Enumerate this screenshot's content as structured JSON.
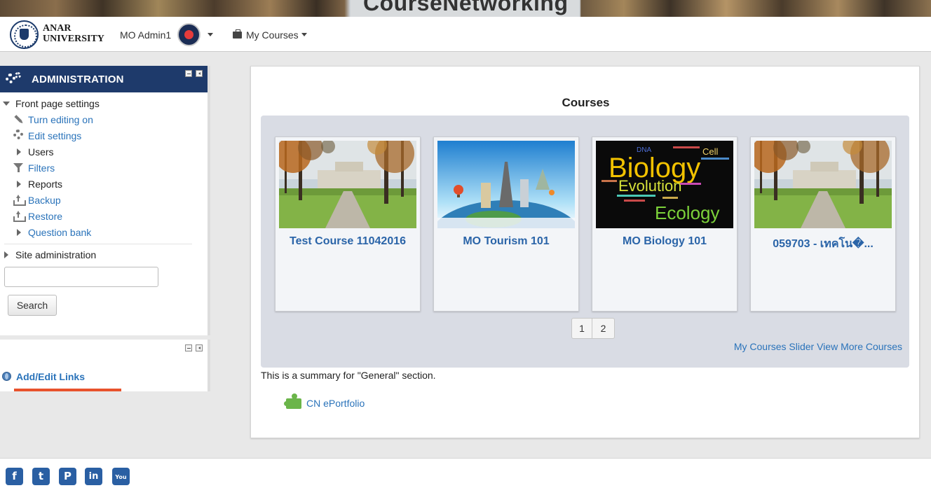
{
  "banner": {
    "title": "CourseNetworking"
  },
  "navbar": {
    "logo_line1": "ANAR",
    "logo_line2": "UNIVERSITY",
    "user_name": "MO Admin1",
    "my_courses": "My Courses"
  },
  "admin": {
    "title": "ADMINISTRATION",
    "front_page_settings": "Front page settings",
    "items": [
      {
        "label": "Turn editing on",
        "icon": "pencil-icon"
      },
      {
        "label": "Edit settings",
        "icon": "gear-icon"
      },
      {
        "label": "Users",
        "icon": "expand-arrow-icon"
      },
      {
        "label": "Filters",
        "icon": "filter-icon"
      },
      {
        "label": "Reports",
        "icon": "expand-arrow-icon"
      },
      {
        "label": "Backup",
        "icon": "backup-icon"
      },
      {
        "label": "Restore",
        "icon": "restore-icon"
      },
      {
        "label": "Question bank",
        "icon": "expand-arrow-icon"
      }
    ],
    "site_administration": "Site administration",
    "search_button": "Search"
  },
  "links_block": {
    "label": "Add/Edit Links"
  },
  "main": {
    "heading": "Courses",
    "courses": [
      {
        "title": "Test Course 11042016",
        "image": "campus-photo"
      },
      {
        "title": "MO Tourism 101",
        "image": "world-landmarks-photo"
      },
      {
        "title": "MO Biology 101",
        "image": "biology-word-cloud"
      },
      {
        "title": "059703 - เทคโน�...",
        "image": "campus-photo"
      }
    ],
    "pages": [
      "1",
      "2"
    ],
    "more_link": "My Courses Slider View More Courses",
    "summary": "This is a summary for \"General\" section.",
    "portfolio_link": "CN ePortfolio"
  },
  "biology_words": {
    "biology": "Biology",
    "evolution": "Evolution",
    "ecology": "Ecology",
    "cell": "Cell",
    "dna": "DNA"
  },
  "footer": {
    "social": [
      {
        "name": "facebook-icon",
        "glyph": "f"
      },
      {
        "name": "twitter-icon",
        "glyph": "t"
      },
      {
        "name": "pinterest-icon",
        "glyph": "P"
      },
      {
        "name": "linkedin-icon",
        "glyph": "in"
      },
      {
        "name": "youtube-icon",
        "glyph": "You"
      }
    ]
  },
  "colors": {
    "admin_header": "#1e3a6b",
    "link": "#2a73ba",
    "course_title": "#2a64a8",
    "accent_bar": "#e8522c"
  }
}
